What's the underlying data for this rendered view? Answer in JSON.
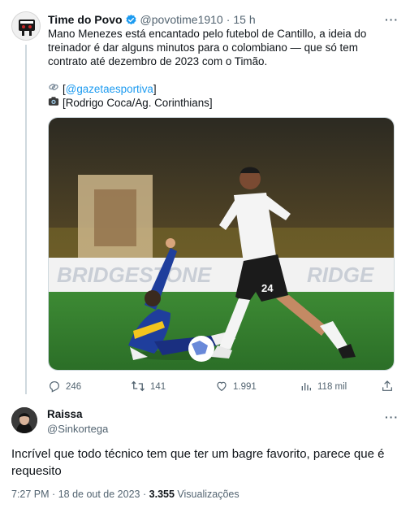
{
  "tweet": {
    "author_name": "Time do Povo",
    "handle": "@povotime1910",
    "separator": "·",
    "time": "15 h",
    "more": "···",
    "text": "Mano Menezes está encantado pelo futebol de Cantillo, a ideia do treinador é dar alguns minutos para o colombiano — que só tem contrato até dezembro de 2023 com o Timão.",
    "credits": [
      {
        "icon": "link-icon",
        "open": "[",
        "link": "@gazetaesportiva",
        "close": "]"
      },
      {
        "icon": "camera-icon",
        "open": "",
        "link": "",
        "close": "[Rodrigo Coca/Ag. Corinthians]"
      }
    ],
    "media": {
      "board_left": "BRIDGESTONE",
      "board_right": "RIDGE",
      "shirt_number": "24"
    },
    "actions": {
      "replies": "246",
      "retweets": "141",
      "likes": "1.991",
      "views": "118 mil"
    },
    "colors": {
      "verified": "#1d9bf0",
      "link": "#1d9bf0",
      "muted": "#536471"
    }
  },
  "reply": {
    "author_name": "Raissa",
    "handle": "@Sinkortega",
    "more": "···",
    "text": "Incrível que todo técnico tem que ter um bagre favorito, parece que é requesito",
    "time": "7:27 PM",
    "dot": "·",
    "date": "18 de out de 2023",
    "views_count": "3.355",
    "views_label": "Visualizações"
  }
}
